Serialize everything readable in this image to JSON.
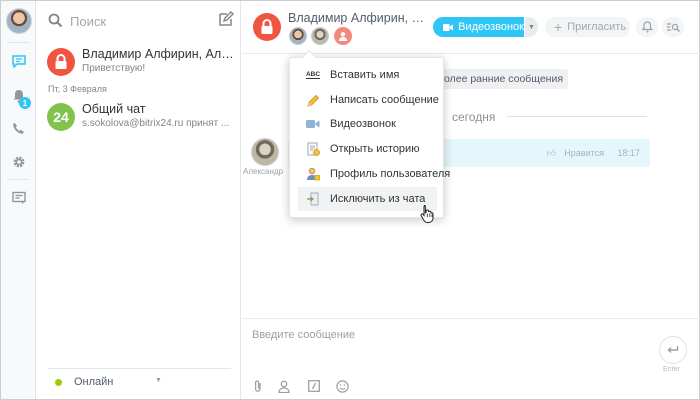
{
  "search": {
    "placeholder": "Поиск"
  },
  "recent": {
    "items": [
      {
        "title": "Владимир Алфирин, Алексан...",
        "last_message": "Приветствую!",
        "avatar_color": "#f0553f"
      },
      {
        "avatar_text": "24",
        "title": "Общий чат",
        "last_message": "s.sokolova@bitrix24.ru принят ...",
        "avatar_color": "#82c34d"
      }
    ],
    "date_divider": "Пт, 3 Февраля"
  },
  "rail": {
    "badge_count": "1"
  },
  "status": {
    "label": "Онлайн",
    "color": "#9dcf00"
  },
  "chat": {
    "title": "Владимир Алфирин, Алексан...",
    "video_call_label": "Видеозвонок",
    "invite_label": "Пригласить",
    "older_messages_label": "олее ранние сообщения",
    "day_label": "сегодня",
    "message": {
      "author": "Александр",
      "like_label": "Нравится",
      "time": "18:17"
    },
    "input_placeholder": "Введите сообщение",
    "enter_label": "Enter"
  },
  "context_menu": {
    "items": [
      {
        "label": "Вставить имя",
        "icon": "abc-icon"
      },
      {
        "label": "Написать сообщение",
        "icon": "pencil-icon"
      },
      {
        "label": "Видеозвонок",
        "icon": "video-camera-icon"
      },
      {
        "label": "Открыть историю",
        "icon": "history-icon"
      },
      {
        "label": "Профиль пользователя",
        "icon": "user-profile-icon"
      },
      {
        "label": "Исключить из чата",
        "icon": "exit-chat-icon"
      }
    ],
    "hovered_index": 5
  },
  "colors": {
    "accent": "#2fc6f6",
    "danger": "#f0553f",
    "online": "#9dcf00"
  }
}
